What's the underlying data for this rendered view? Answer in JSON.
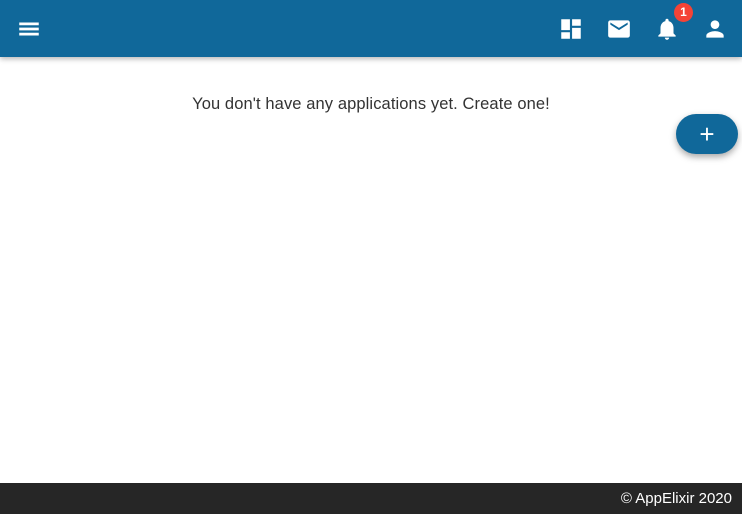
{
  "header": {
    "bg_color": "#10689a",
    "menu_icon": "hamburger-menu-icon",
    "actions": [
      {
        "icon": "dashboard-icon"
      },
      {
        "icon": "mail-icon"
      },
      {
        "icon": "notifications-bell-icon",
        "badge": "1"
      },
      {
        "icon": "person-icon"
      }
    ]
  },
  "main": {
    "empty_message": "You don't have any applications yet. Create one!",
    "fab": {
      "icon": "plus-icon",
      "label": "+"
    }
  },
  "footer": {
    "bg_color": "#262626",
    "copyright": "© AppElixir 2020"
  },
  "colors": {
    "accent": "#10689a",
    "badge_red": "#f44336",
    "text_dark": "#333333",
    "footer_dark": "#262626"
  }
}
